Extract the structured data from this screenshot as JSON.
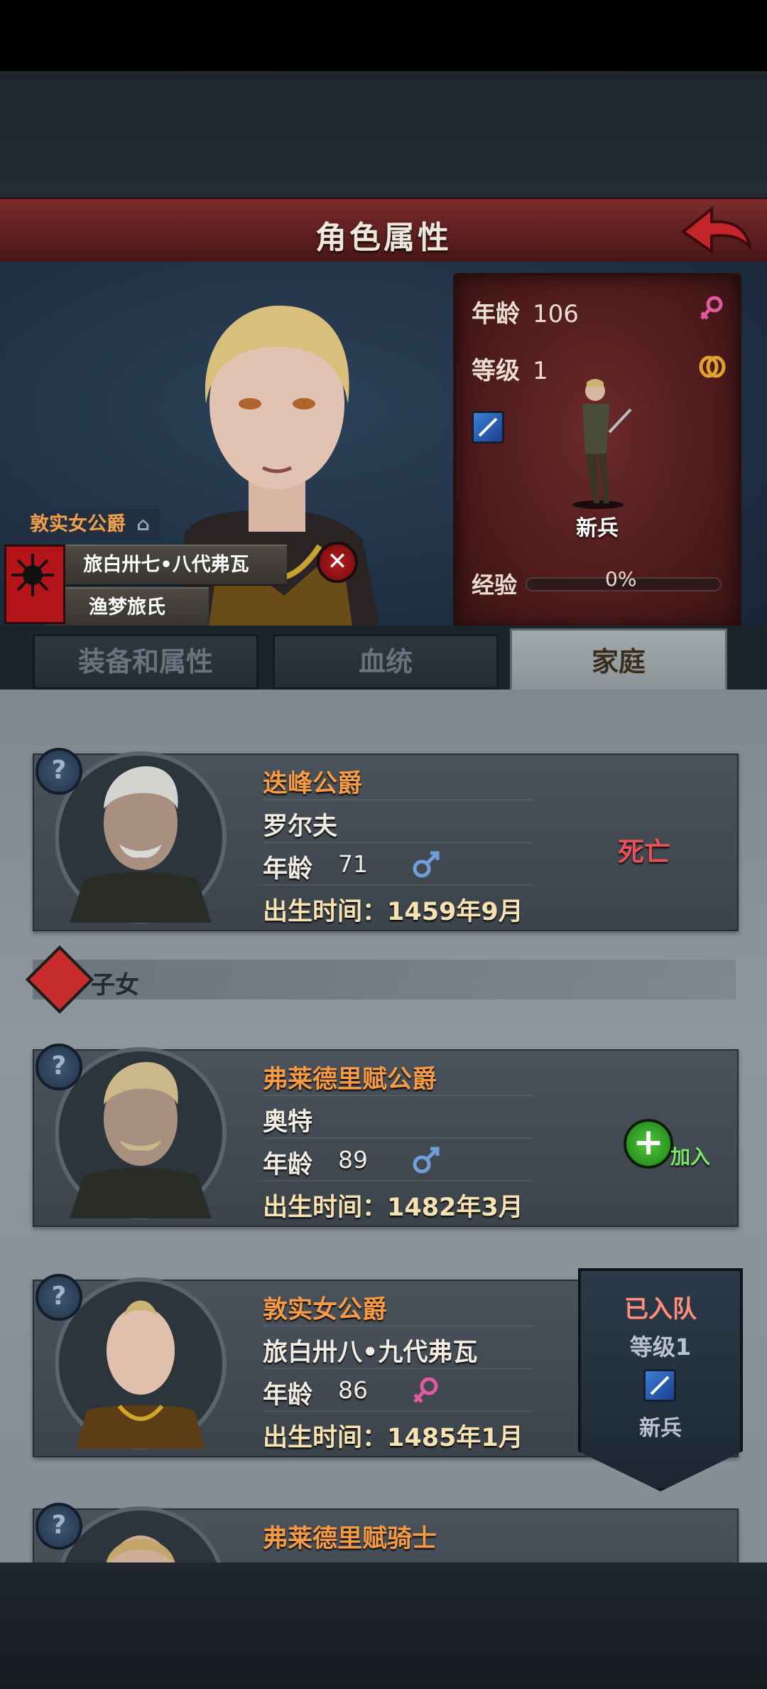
{
  "header": {
    "title": "角色属性"
  },
  "character": {
    "title": "敦实女公爵",
    "banner_name": "旅白卅七•八代弗瓦",
    "clan": "渔梦旅氏",
    "stats": {
      "age_label": "年龄",
      "age_value": "106",
      "level_label": "等级",
      "level_value": "1",
      "unit_name": "新兵",
      "exp_label": "经验",
      "exp_value": "0%",
      "exp_fraction": 0
    },
    "gender": "female"
  },
  "tabs": [
    {
      "label": "装备和属性"
    },
    {
      "label": "血统"
    },
    {
      "label": "家庭"
    }
  ],
  "family": {
    "parent": {
      "title": "迭峰公爵",
      "name": "罗尔夫",
      "age_label": "年龄",
      "age": "71",
      "gender": "male",
      "birth": "出生时间：1459年9月",
      "status": "死亡"
    },
    "children_section": "子女",
    "children": [
      {
        "title": "弗莱德里赋公爵",
        "name": "奥特",
        "age_label": "年龄",
        "age": "89",
        "gender": "male",
        "birth": "出生时间：1482年3月",
        "join_label": "加入"
      },
      {
        "title": "敦实女公爵",
        "name": "旅白卅八•九代弗瓦",
        "age_label": "年龄",
        "age": "86",
        "gender": "female",
        "birth": "出生时间：1485年1月",
        "joined": {
          "title": "已入队",
          "level": "等级1",
          "unit": "新兵"
        }
      },
      {
        "title": "弗莱德里赋骑士"
      }
    ]
  },
  "colors": {
    "header_red": "#5e1f20",
    "title_orange": "#f59a45",
    "dead_red": "#e8505a",
    "join_green": "#4ccb3a"
  },
  "icons": [
    "back-arrow-icon",
    "female-icon",
    "male-icon",
    "ring-icon",
    "sword-skill-icon",
    "help-icon",
    "remove-icon",
    "add-icon",
    "family-section-icon"
  ]
}
